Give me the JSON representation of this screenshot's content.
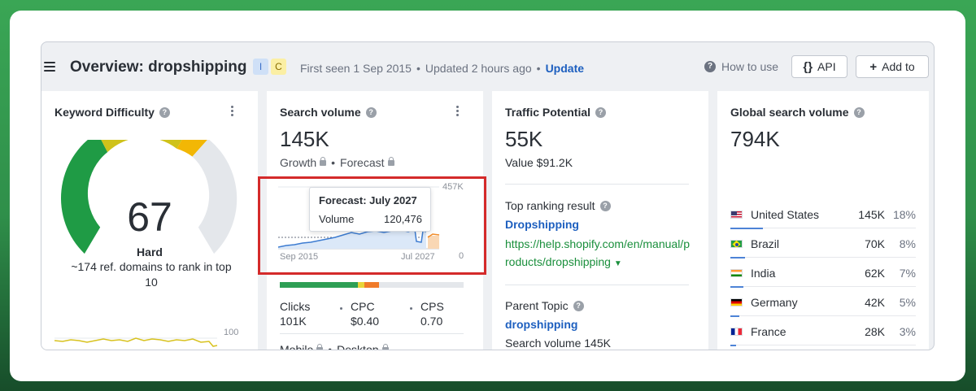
{
  "header": {
    "title": "Overview: dropshipping",
    "badges": [
      "I",
      "C"
    ],
    "first_seen": "First seen 1 Sep 2015",
    "updated": "Updated 2 hours ago",
    "update_link": "Update",
    "help_label": "How to use",
    "api_label": "API",
    "add_label": "Add to"
  },
  "keyword_difficulty": {
    "title": "Keyword Difficulty",
    "score": "67",
    "score_value": 67,
    "level": "Hard",
    "description": "~174 ref. domains to rank in top 10",
    "history_axis_max": "100"
  },
  "search_volume": {
    "title": "Search volume",
    "value": "145K",
    "growth_label": "Growth",
    "forecast_label": "Forecast",
    "chart_max_label": "457K",
    "chart_zero_label": "0",
    "chart_start_label": "Sep 2015",
    "chart_end_label": "Jul 2027",
    "tooltip_title": "Forecast: July 2027",
    "tooltip_key": "Volume",
    "tooltip_value": "120,476",
    "clicks_label": "Clicks",
    "clicks_value": "101K",
    "cpc_label": "CPC",
    "cpc_value": "$0.40",
    "cps_label": "CPS",
    "cps_value": "0.70",
    "mobile_label": "Mobile",
    "desktop_label": "Desktop"
  },
  "traffic_potential": {
    "title": "Traffic Potential",
    "value": "55K",
    "value_label": "Value $91.2K",
    "top_ranking_label": "Top ranking result",
    "top_ranking_title": "Dropshipping",
    "top_ranking_url": "https://help.shopify.com/en/manual/products/dropshipping",
    "parent_topic_label": "Parent Topic",
    "parent_topic_link": "dropshipping",
    "parent_topic_sv": "Search volume 145K"
  },
  "global_search_volume": {
    "title": "Global search volume",
    "value": "794K",
    "countries": [
      {
        "name": "United States",
        "volume": "145K",
        "pct": "18%",
        "share": 0.18
      },
      {
        "name": "Brazil",
        "volume": "70K",
        "pct": "8%",
        "share": 0.08
      },
      {
        "name": "India",
        "volume": "62K",
        "pct": "7%",
        "share": 0.07
      },
      {
        "name": "Germany",
        "volume": "42K",
        "pct": "5%",
        "share": 0.05
      },
      {
        "name": "France",
        "volume": "28K",
        "pct": "3%",
        "share": 0.03
      }
    ]
  },
  "colors": {
    "accent_blue": "#1d5fbf",
    "url_green": "#1a8f3c",
    "highlight_red": "#d42a2a",
    "gauge_green": "#1f9b45",
    "gauge_yellow": "#cfc21a",
    "gauge_orange": "#f2b705",
    "gauge_empty": "#e4e7eb"
  }
}
